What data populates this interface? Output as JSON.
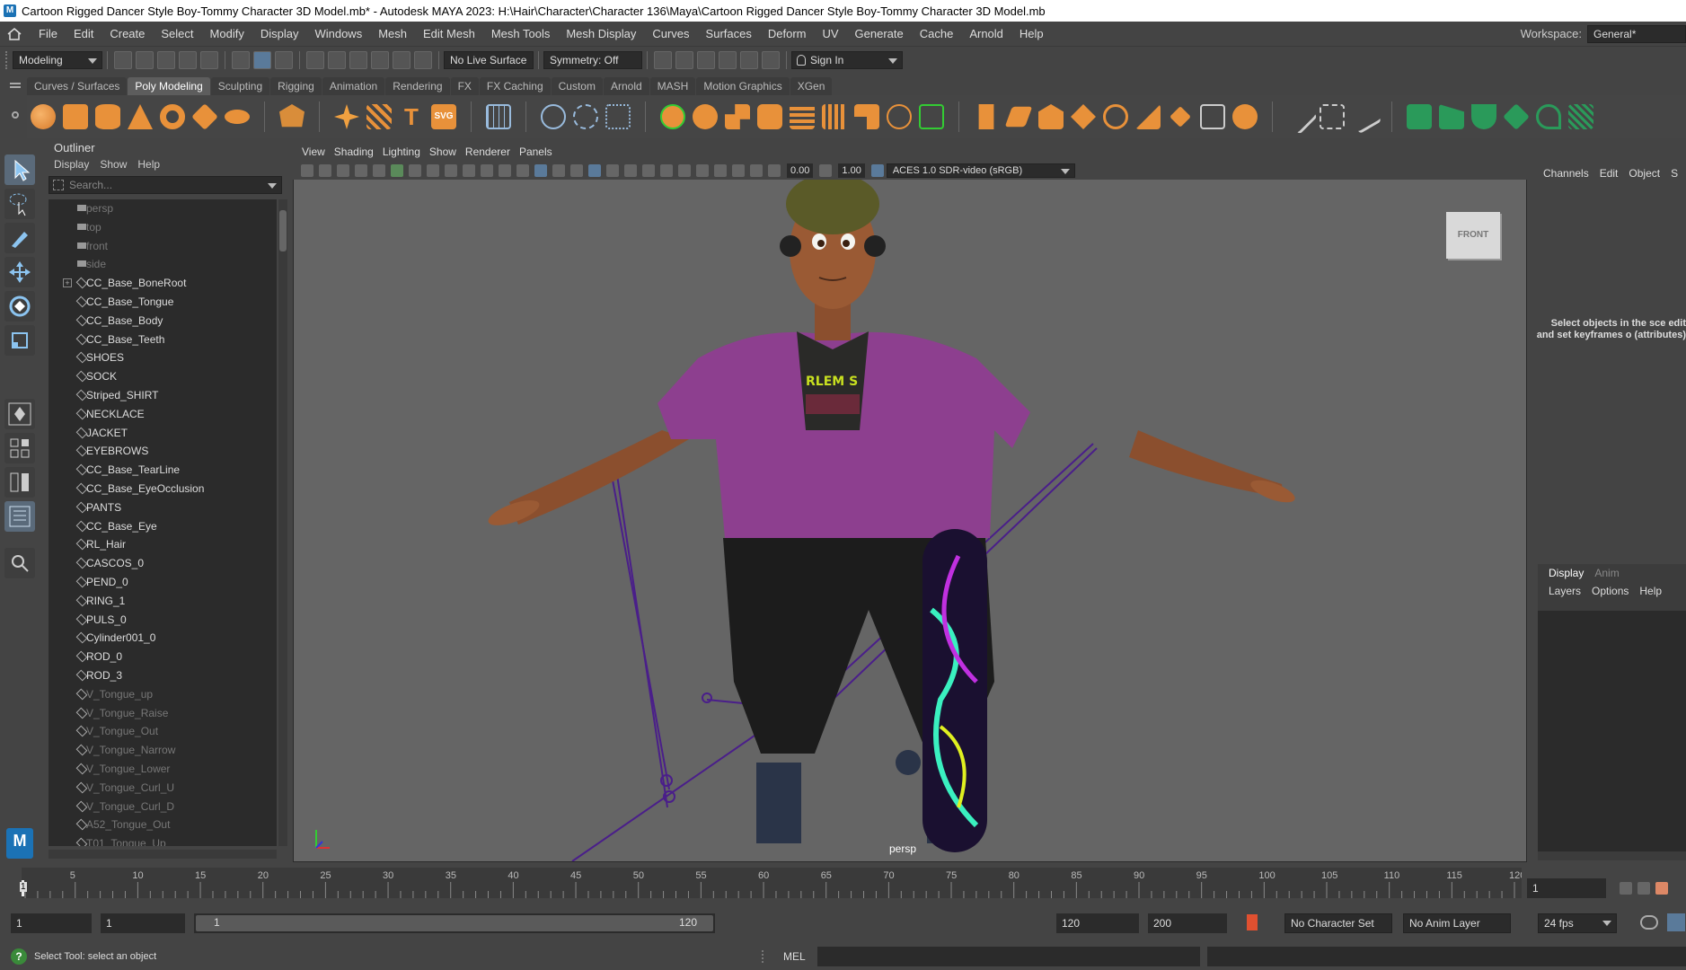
{
  "title_bar": {
    "text": "Cartoon Rigged Dancer Style Boy-Tommy Character 3D Model.mb* - Autodesk MAYA 2023: H:\\Hair\\Character\\Character 136\\Maya\\Cartoon Rigged Dancer Style Boy-Tommy Character 3D Model.mb"
  },
  "menubar": {
    "items": [
      "File",
      "Edit",
      "Create",
      "Select",
      "Modify",
      "Display",
      "Windows",
      "Mesh",
      "Edit Mesh",
      "Mesh Tools",
      "Mesh Display",
      "Curves",
      "Surfaces",
      "Deform",
      "UV",
      "Generate",
      "Cache",
      "Arnold",
      "Help"
    ],
    "workspace_label": "Workspace:",
    "workspace_value": "General*"
  },
  "statusline": {
    "mode": "Modeling",
    "live_surface": "No Live Surface",
    "symmetry": "Symmetry: Off",
    "sign_in": "Sign In"
  },
  "shelf_tabs": [
    "Curves / Surfaces",
    "Poly Modeling",
    "Sculpting",
    "Rigging",
    "Animation",
    "Rendering",
    "FX",
    "FX Caching",
    "Custom",
    "Arnold",
    "MASH",
    "Motion Graphics",
    "XGen"
  ],
  "active_shelf_tab": "Poly Modeling",
  "outliner": {
    "title": "Outliner",
    "menu": [
      "Display",
      "Show",
      "Help"
    ],
    "search_placeholder": "Search...",
    "items": [
      {
        "label": "persp",
        "type": "camera",
        "dim": true
      },
      {
        "label": "top",
        "type": "camera",
        "dim": true
      },
      {
        "label": "front",
        "type": "camera",
        "dim": true
      },
      {
        "label": "side",
        "type": "camera",
        "dim": true
      },
      {
        "label": "CC_Base_BoneRoot",
        "type": "joint",
        "expand": true
      },
      {
        "label": "CC_Base_Tongue",
        "type": "mesh"
      },
      {
        "label": "CC_Base_Body",
        "type": "mesh"
      },
      {
        "label": "CC_Base_Teeth",
        "type": "mesh"
      },
      {
        "label": "SHOES",
        "type": "mesh"
      },
      {
        "label": "SOCK",
        "type": "mesh"
      },
      {
        "label": "Striped_SHIRT",
        "type": "mesh"
      },
      {
        "label": "NECKLACE",
        "type": "mesh"
      },
      {
        "label": "JACKET",
        "type": "mesh"
      },
      {
        "label": "EYEBROWS",
        "type": "mesh"
      },
      {
        "label": "CC_Base_TearLine",
        "type": "mesh"
      },
      {
        "label": "CC_Base_EyeOcclusion",
        "type": "mesh"
      },
      {
        "label": "PANTS",
        "type": "mesh"
      },
      {
        "label": "CC_Base_Eye",
        "type": "mesh"
      },
      {
        "label": "RL_Hair",
        "type": "mesh"
      },
      {
        "label": "CASCOS_0",
        "type": "mesh"
      },
      {
        "label": "PEND_0",
        "type": "mesh"
      },
      {
        "label": "RING_1",
        "type": "mesh"
      },
      {
        "label": "PULS_0",
        "type": "mesh"
      },
      {
        "label": "Cylinder001_0",
        "type": "mesh"
      },
      {
        "label": "ROD_0",
        "type": "mesh"
      },
      {
        "label": "ROD_3",
        "type": "mesh"
      },
      {
        "label": "V_Tongue_up",
        "type": "mesh",
        "dim": true
      },
      {
        "label": "V_Tongue_Raise",
        "type": "mesh",
        "dim": true
      },
      {
        "label": "V_Tongue_Out",
        "type": "mesh",
        "dim": true
      },
      {
        "label": "V_Tongue_Narrow",
        "type": "mesh",
        "dim": true
      },
      {
        "label": "V_Tongue_Lower",
        "type": "mesh",
        "dim": true
      },
      {
        "label": "V_Tongue_Curl_U",
        "type": "mesh",
        "dim": true
      },
      {
        "label": "V_Tongue_Curl_D",
        "type": "mesh",
        "dim": true
      },
      {
        "label": "A52_Tongue_Out",
        "type": "mesh",
        "dim": true
      },
      {
        "label": "T01_Tongue_Up",
        "type": "mesh",
        "dim": true
      }
    ]
  },
  "viewport": {
    "menu": [
      "View",
      "Shading",
      "Lighting",
      "Show",
      "Renderer",
      "Panels"
    ],
    "exposure": "0.00",
    "gamma": "1.00",
    "color_space": "ACES 1.0 SDR-video (sRGB)",
    "view_cube_label": "FRONT",
    "camera_label": "persp",
    "shirt_text": "RLEM S"
  },
  "channel_box": {
    "menu": [
      "Channels",
      "Edit",
      "Object",
      "S"
    ],
    "message": "Select objects in the sce edit and set keyframes o (attributes)"
  },
  "layer_editor": {
    "tabs": [
      "Display",
      "Anim"
    ],
    "menu": [
      "Layers",
      "Options",
      "Help"
    ]
  },
  "timeline": {
    "ticks": [
      "5",
      "10",
      "15",
      "20",
      "25",
      "30",
      "35",
      "40",
      "45",
      "50",
      "55",
      "60",
      "65",
      "70",
      "75",
      "80",
      "85",
      "90",
      "95",
      "100",
      "105",
      "110",
      "115",
      "120"
    ],
    "current_frame_marker": "1",
    "current_frame": "1"
  },
  "range": {
    "start": "1",
    "playback_start": "1",
    "slider_start": "1",
    "slider_end": "120",
    "playback_end": "120",
    "end": "200",
    "character_set": "No Character Set",
    "anim_layer": "No Anim Layer",
    "fps": "24 fps"
  },
  "command_line": {
    "help_text": "Select Tool: select an object",
    "language": "MEL"
  },
  "toolbox": {
    "logo": "M"
  }
}
